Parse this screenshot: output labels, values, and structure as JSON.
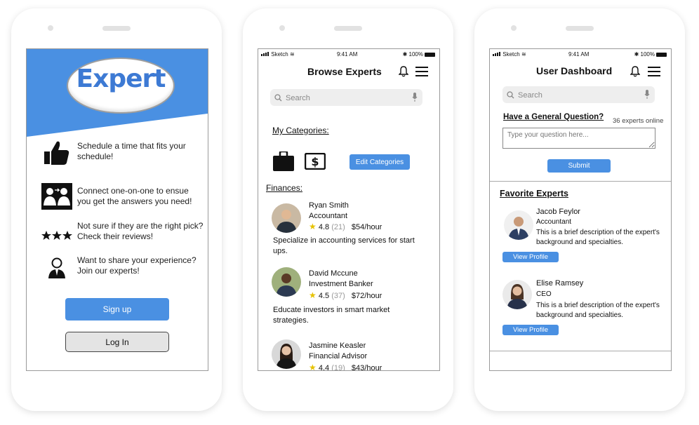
{
  "colors": {
    "accent": "#4a90e2",
    "star": "#e6c200"
  },
  "status_bar": {
    "carrier": "Sketch",
    "time": "9:41 AM",
    "battery": "100%"
  },
  "landing": {
    "logo": "Expert",
    "features": [
      {
        "icon": "thumbs-up-icon",
        "text": "Schedule a time that fits your schedule!"
      },
      {
        "icon": "people-connect-icon",
        "text": "Connect one-on-one to ensue you get the answers you need!"
      },
      {
        "icon": "three-stars-icon",
        "text": "Not sure if they are the right pick? Check their reviews!"
      },
      {
        "icon": "person-icon",
        "text": "Want to share your experience? Join our experts!"
      }
    ],
    "signup_label": "Sign up",
    "login_label": "Log In"
  },
  "browse": {
    "title": "Browse Experts",
    "search_placeholder": "Search",
    "my_categories": "My Categories:",
    "edit_categories": "Edit Categories",
    "category_heading": "Finances:",
    "experts": [
      {
        "name": "Ryan Smith",
        "role": "Accountant",
        "rating": "4.8",
        "reviews": "(21)",
        "rate": "$54/hour",
        "description": "Specialize in accounting services for start ups."
      },
      {
        "name": "David Mccune",
        "role": "Investment Banker",
        "rating": "4.5",
        "reviews": "(37)",
        "rate": "$72/hour",
        "description": "Educate investors in smart market strategies."
      },
      {
        "name": "Jasmine Keasler",
        "role": "Financial Advisor",
        "rating": "4.4",
        "reviews": "(19)",
        "rate": "$43/hour",
        "description": ""
      }
    ]
  },
  "dashboard": {
    "title": "User Dashboard",
    "search_placeholder": "Search",
    "question_heading": "Have a General Question?",
    "online_count": "36 experts online",
    "question_placeholder": "Type your question here...",
    "submit_label": "Submit",
    "favorites_heading": "Favorite Experts",
    "favorites": [
      {
        "name": "Jacob Feylor",
        "role": "Accountant",
        "description": "This is a brief description of the expert's background and specialties.",
        "button": "View Profile"
      },
      {
        "name": "Elise Ramsey",
        "role": "CEO",
        "description": "This is a brief description of the expert's background and specialties.",
        "button": "View Profile"
      }
    ]
  }
}
